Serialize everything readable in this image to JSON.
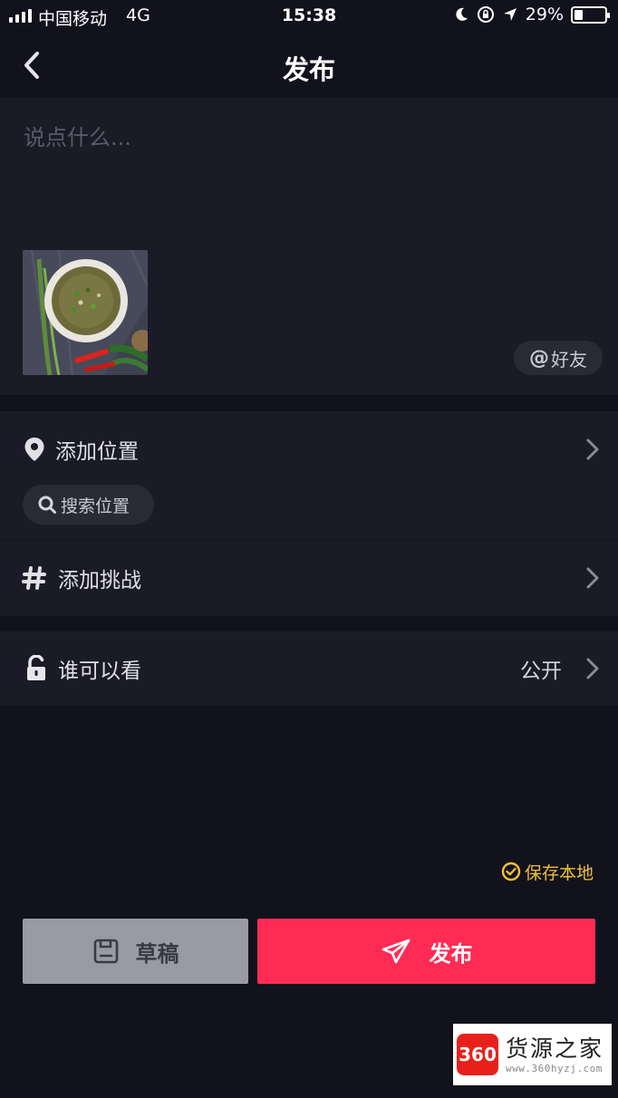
{
  "status_bar": {
    "carrier": "中国移动",
    "network": "4G",
    "time": "15:38",
    "battery_percent": "29%",
    "battery_level": 0.29
  },
  "nav": {
    "title": "发布"
  },
  "compose": {
    "caption_placeholder": "说点什么...",
    "caption_value": "",
    "mention_label": "好友",
    "mention_prefix": "@"
  },
  "location": {
    "label": "添加位置",
    "search_label": "搜索位置"
  },
  "challenge": {
    "label": "添加挑战"
  },
  "privacy": {
    "label": "谁可以看",
    "value": "公开"
  },
  "save_local": {
    "label": "保存本地"
  },
  "actions": {
    "draft_label": "草稿",
    "publish_label": "发布"
  },
  "watermark": {
    "logo_text": "360",
    "name": "货源之家",
    "url": "www.360hyzj.com"
  },
  "colors": {
    "background": "#12121c",
    "card": "#1b1b27",
    "publish": "#fe2c55",
    "draft": "#9a9aa2",
    "save_accent": "#f1c033"
  }
}
